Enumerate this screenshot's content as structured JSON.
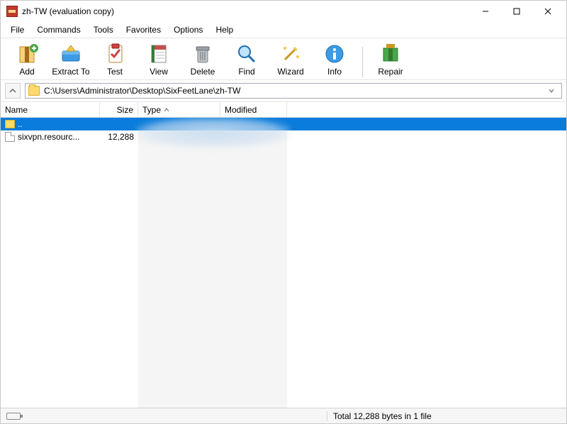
{
  "window": {
    "title": "zh-TW (evaluation copy)"
  },
  "menu": {
    "file": "File",
    "commands": "Commands",
    "tools": "Tools",
    "favorites": "Favorites",
    "options": "Options",
    "help": "Help"
  },
  "toolbar": {
    "add": "Add",
    "extract": "Extract To",
    "test": "Test",
    "view": "View",
    "delete": "Delete",
    "find": "Find",
    "wizard": "Wizard",
    "info": "Info",
    "repair": "Repair"
  },
  "address": {
    "path": "C:\\Users\\Administrator\\Desktop\\SixFeetLane\\zh-TW"
  },
  "columns": {
    "name": "Name",
    "size": "Size",
    "type": "Type",
    "modified": "Modified"
  },
  "rows": {
    "up": {
      "name": ".."
    },
    "file1": {
      "name": "sixvpn.resourc...",
      "size": "12,288"
    }
  },
  "status": {
    "summary": "Total 12,288 bytes in 1 file"
  }
}
